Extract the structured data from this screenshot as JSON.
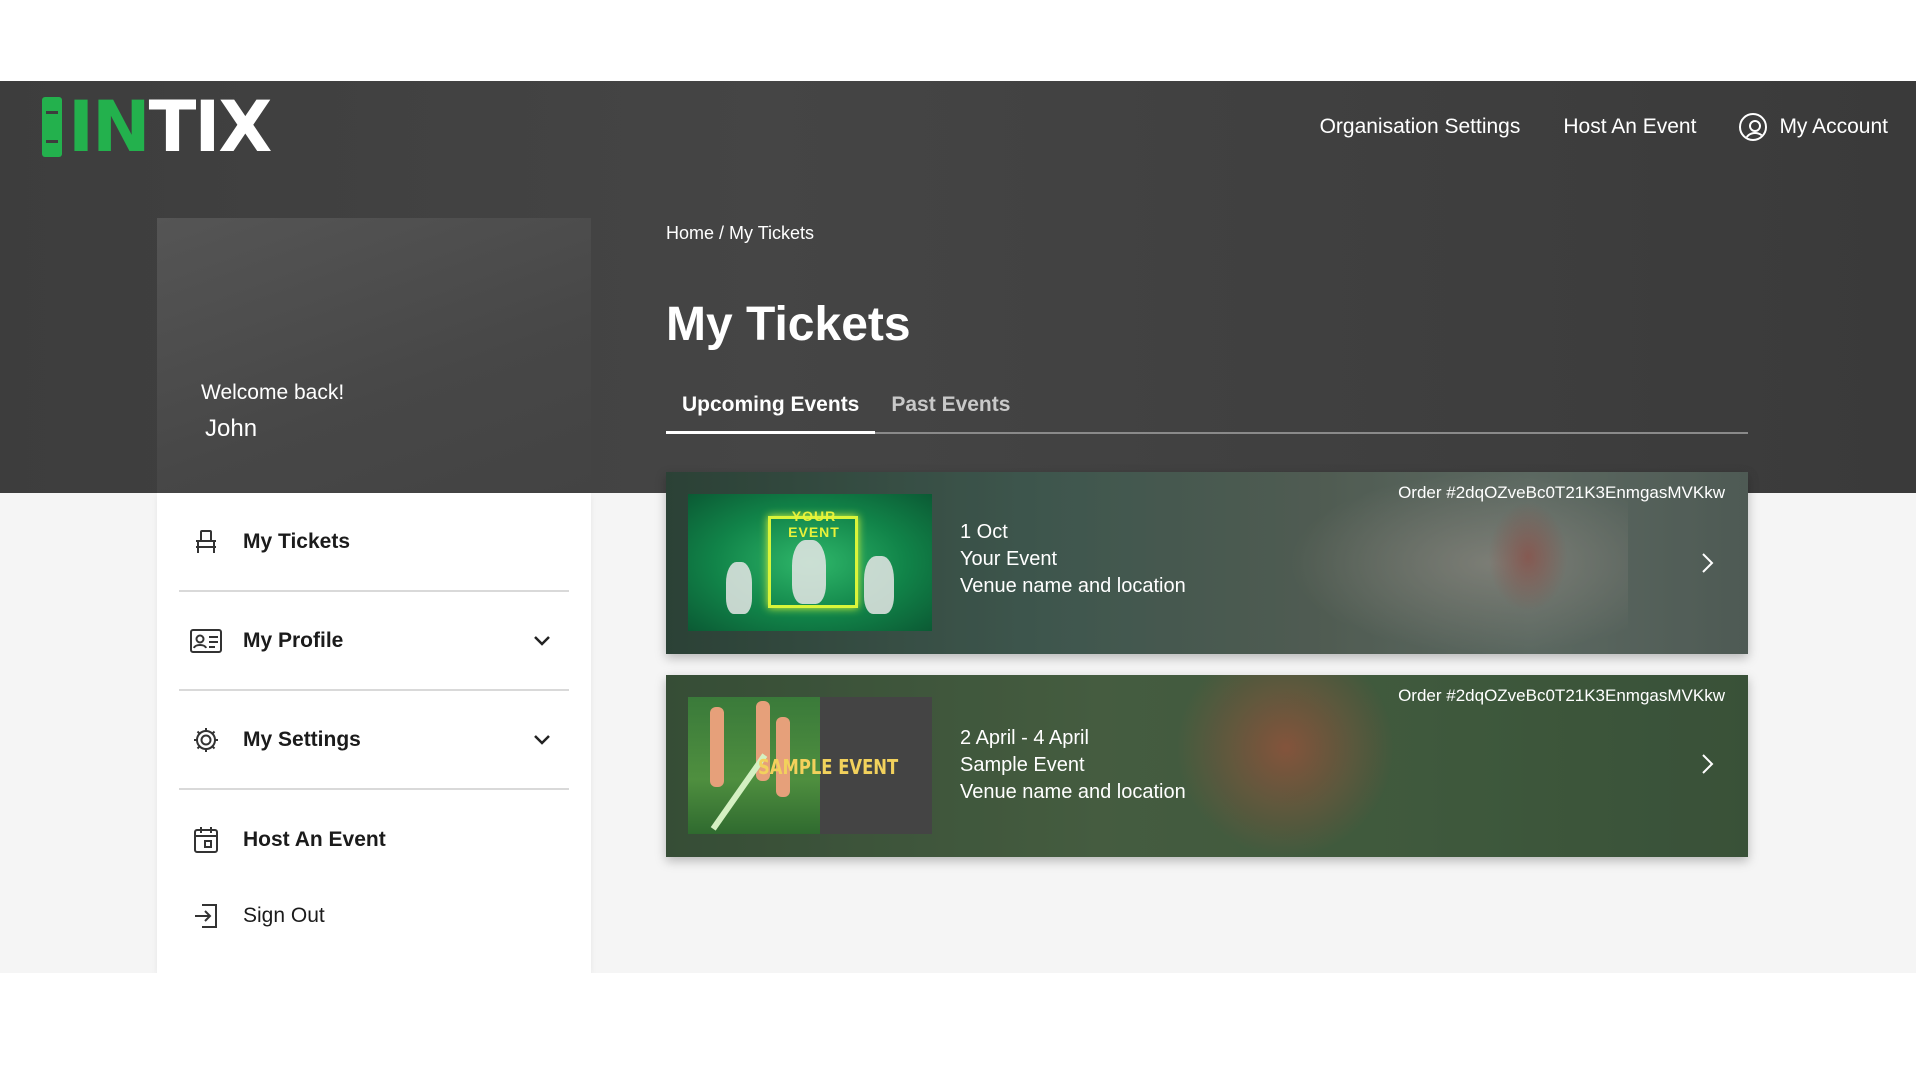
{
  "header": {
    "logo": {
      "accent": "IN",
      "rest": "TIX"
    },
    "nav": {
      "organisation_settings": "Organisation Settings",
      "host_an_event": "Host An Event",
      "my_account": "My Account"
    }
  },
  "sidebar": {
    "welcome": "Welcome back!",
    "username": "John",
    "items": [
      {
        "label": "My Tickets",
        "icon": "ticket-icon"
      },
      {
        "label": "My Profile",
        "icon": "id-card-icon",
        "expandable": true
      },
      {
        "label": "My Settings",
        "icon": "gear-icon",
        "expandable": true
      },
      {
        "label": "Host An Event",
        "icon": "calendar-icon"
      },
      {
        "label": "Sign Out",
        "icon": "sign-out-icon"
      }
    ]
  },
  "main": {
    "breadcrumb": "Home / My Tickets",
    "title": "My Tickets",
    "tabs": [
      {
        "label": "Upcoming Events",
        "active": true
      },
      {
        "label": "Past Events",
        "active": false
      }
    ],
    "tickets": [
      {
        "order": "Order #2dqOZveBc0T21K3EnmgasMVKkw",
        "date": "1 Oct",
        "event": "Your Event",
        "venue": "Venue name and location",
        "thumb_text": "YOUR EVENT"
      },
      {
        "order": "Order #2dqOZveBc0T21K3EnmgasMVKkw",
        "date": "2 April - 4 April",
        "event": "Sample Event",
        "venue": "Venue name and location",
        "thumb_text": "SAMPLE EVENT"
      }
    ]
  },
  "colors": {
    "brand_green": "#23b14d",
    "hero": "#404040",
    "page_bg": "#f5f5f5"
  }
}
